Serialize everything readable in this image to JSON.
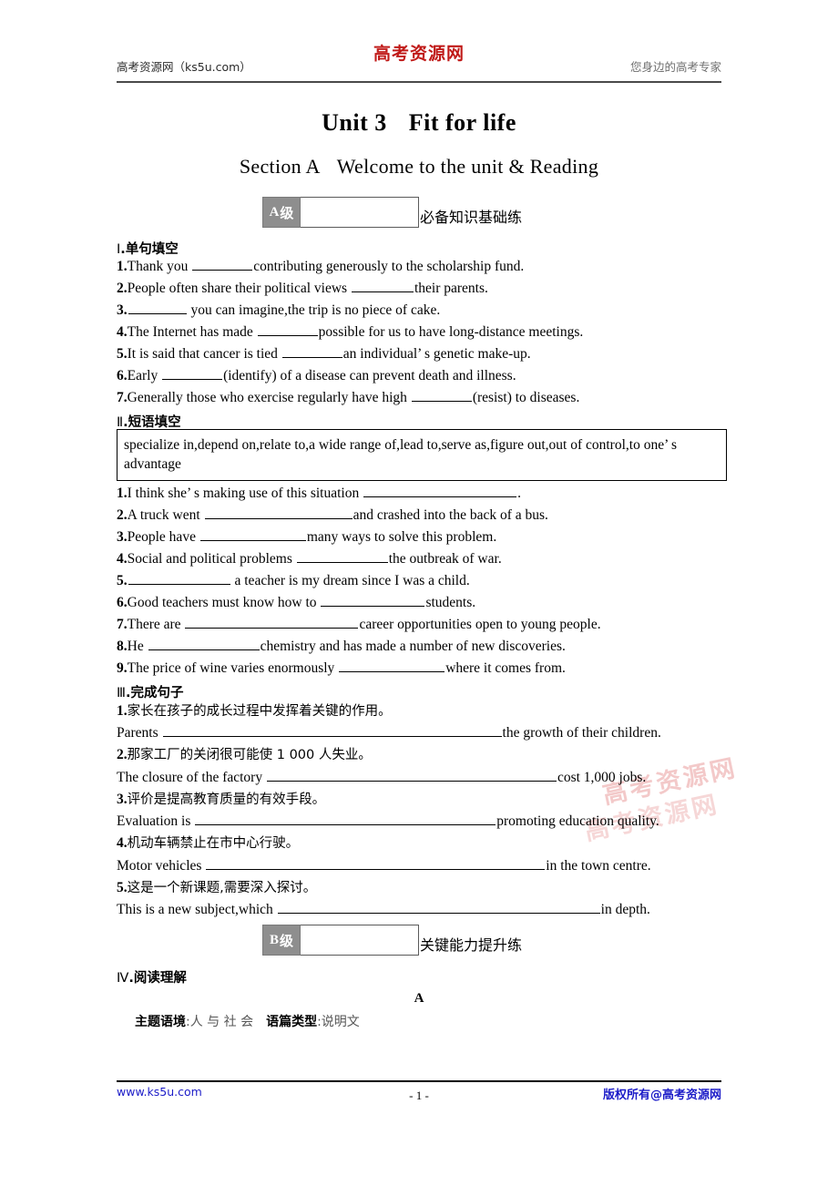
{
  "header": {
    "logo": "高考资源网",
    "left": "高考资源网（ks5u.com）",
    "right": "您身边的高考专家"
  },
  "titles": {
    "unit_no": "Unit 3",
    "unit_name": "Fit for life",
    "section_no": "Section A",
    "section_name": "Welcome to the unit & Reading"
  },
  "levels": {
    "a": {
      "tag_letter": "A",
      "tag_cn": "级",
      "label": "必备知识基础练"
    },
    "b": {
      "tag_letter": "B",
      "tag_cn": "级",
      "label": "关键能力提升练"
    }
  },
  "sections": {
    "s1": {
      "roman": "Ⅰ",
      "title": ".单句填空"
    },
    "s2": {
      "roman": "Ⅱ",
      "title": ".短语填空"
    },
    "s3": {
      "roman": "Ⅲ",
      "title": ".完成句子"
    },
    "s4": {
      "roman": "Ⅳ",
      "title": ".阅读理解"
    }
  },
  "q1": [
    {
      "num": "1.",
      "pre": "Thank you ",
      "blank": 66,
      "post": "contributing generously to the scholarship fund."
    },
    {
      "num": "2.",
      "pre": "People often share their political views ",
      "blank": 68,
      "post": "their parents."
    },
    {
      "num": "3.",
      "pre": "",
      "blank": 64,
      "post": " you can imagine,the trip is no piece of cake."
    },
    {
      "num": "4.",
      "pre": "The Internet has made ",
      "blank": 66,
      "post": "possible for us to have long-distance meetings."
    },
    {
      "num": "5.",
      "pre": "It is said that cancer is tied ",
      "blank": 66,
      "post": "an individual’ s genetic make-up."
    },
    {
      "num": "6.",
      "pre": "Early ",
      "blank": 66,
      "post": "(identify) of a disease can prevent death and illness."
    },
    {
      "num": "7.",
      "pre": "Generally those who exercise regularly have high ",
      "blank": 66,
      "post": "(resist) to diseases."
    }
  ],
  "wordbank": "specialize in,depend on,relate to,a wide range of,lead to,serve as,figure out,out of control,to one’ s advantage",
  "q2": [
    {
      "num": "1.",
      "pre": "I think she’ s making use of this situation ",
      "blank": 168,
      "post": "."
    },
    {
      "num": "2.",
      "pre": "A truck went ",
      "blank": 162,
      "post": "and crashed into the back of a bus."
    },
    {
      "num": "3.",
      "pre": "People have ",
      "blank": 116,
      "post": "many ways to solve this problem."
    },
    {
      "num": "4.",
      "pre": "Social and political problems ",
      "blank": 100,
      "post": "the outbreak of war."
    },
    {
      "num": "5.",
      "pre": "",
      "blank": 112,
      "post": " a teacher is my dream since I was a child."
    },
    {
      "num": "6.",
      "pre": "Good teachers must know how to ",
      "blank": 114,
      "post": "students."
    },
    {
      "num": "7.",
      "pre": "There are ",
      "blank": 190,
      "post": "career opportunities open to young people."
    },
    {
      "num": "8.",
      "pre": "He ",
      "blank": 122,
      "post": "chemistry and has made a number of new discoveries."
    },
    {
      "num": "9.",
      "pre": "The price of wine varies enormously ",
      "blank": 116,
      "post": "where it comes from."
    }
  ],
  "q3": [
    {
      "num": "1.",
      "cn": "家长在孩子的成长过程中发挥着关键的作用。",
      "pre": "Parents ",
      "blank": 372,
      "post": "the growth of their children."
    },
    {
      "num": "2.",
      "cn": "那家工厂的关闭很可能使 1 000 人失业。",
      "pre": "The closure of the factory ",
      "blank": 318,
      "post": "cost 1,000 jobs."
    },
    {
      "num": "3.",
      "cn": "评价是提高教育质量的有效手段。",
      "pre": "Evaluation is ",
      "blank": 330,
      "post": "promoting education quality."
    },
    {
      "num": "4.",
      "cn": "机动车辆禁止在市中心行驶。",
      "pre": "Motor vehicles ",
      "blank": 372,
      "post": "in the town centre."
    },
    {
      "num": "5.",
      "cn": "这是一个新课题,需要深入探讨。",
      "pre": "This is a new subject,which ",
      "blank": 354,
      "post": "in depth."
    }
  ],
  "passage": {
    "letter": "A",
    "theme_label": "主题语境",
    "theme_value": ":人 与 社 会",
    "type_label": "语篇类型",
    "type_value": ":说明文"
  },
  "footer": {
    "left": "www.ks5u.com",
    "center": "- 1 -",
    "right": "版权所有@高考资源网"
  },
  "watermark": {
    "text1": "高考资源网",
    "text2": "高考资源网"
  },
  "colors": {
    "logo_red": "#c01a18",
    "footer_blue": "#1c1cc8",
    "badge_gray": "#8e8e8e",
    "header_right_gray": "#6f6f6f"
  }
}
